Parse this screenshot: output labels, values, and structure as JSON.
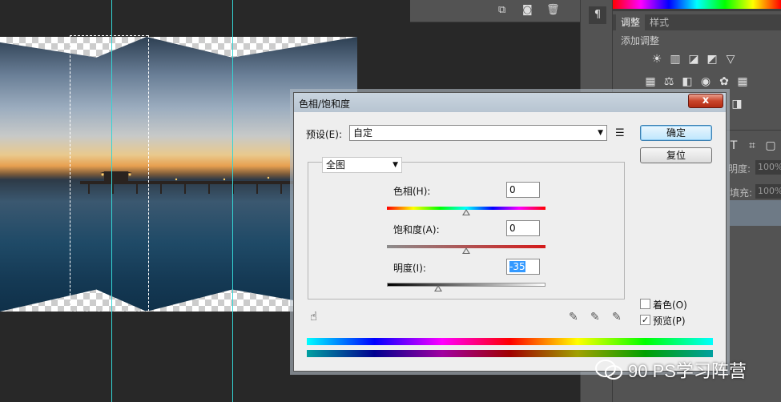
{
  "dialog": {
    "title": "色相/饱和度",
    "close_label": "x",
    "preset_label": "预设(E):",
    "preset_value": "自定",
    "channel_value": "全图",
    "hue_label": "色相(H):",
    "hue_value": "0",
    "saturation_label": "饱和度(A):",
    "saturation_value": "0",
    "lightness_label": "明度(I):",
    "lightness_value": "-35",
    "ok_label": "确定",
    "reset_label": "复位",
    "colorize_label": "着色(O)",
    "colorize_checked": false,
    "preview_label": "预览(P)",
    "preview_checked": true,
    "sliders": {
      "hue": 0,
      "saturation": 0,
      "lightness": -35
    }
  },
  "right_panel": {
    "tabs": [
      "调整",
      "样式"
    ],
    "add_adjustment": "添加调整",
    "opacity_label": "明度:",
    "opacity_value": "100%",
    "fill_label": "填充:",
    "fill_value": "100%"
  },
  "watermark": "90 PS学习阵营",
  "colors": {
    "guide": "#34d5d5",
    "panel_bg": "#535353",
    "dialog_bg": "#eeeeee",
    "selection": "#3399ff"
  }
}
